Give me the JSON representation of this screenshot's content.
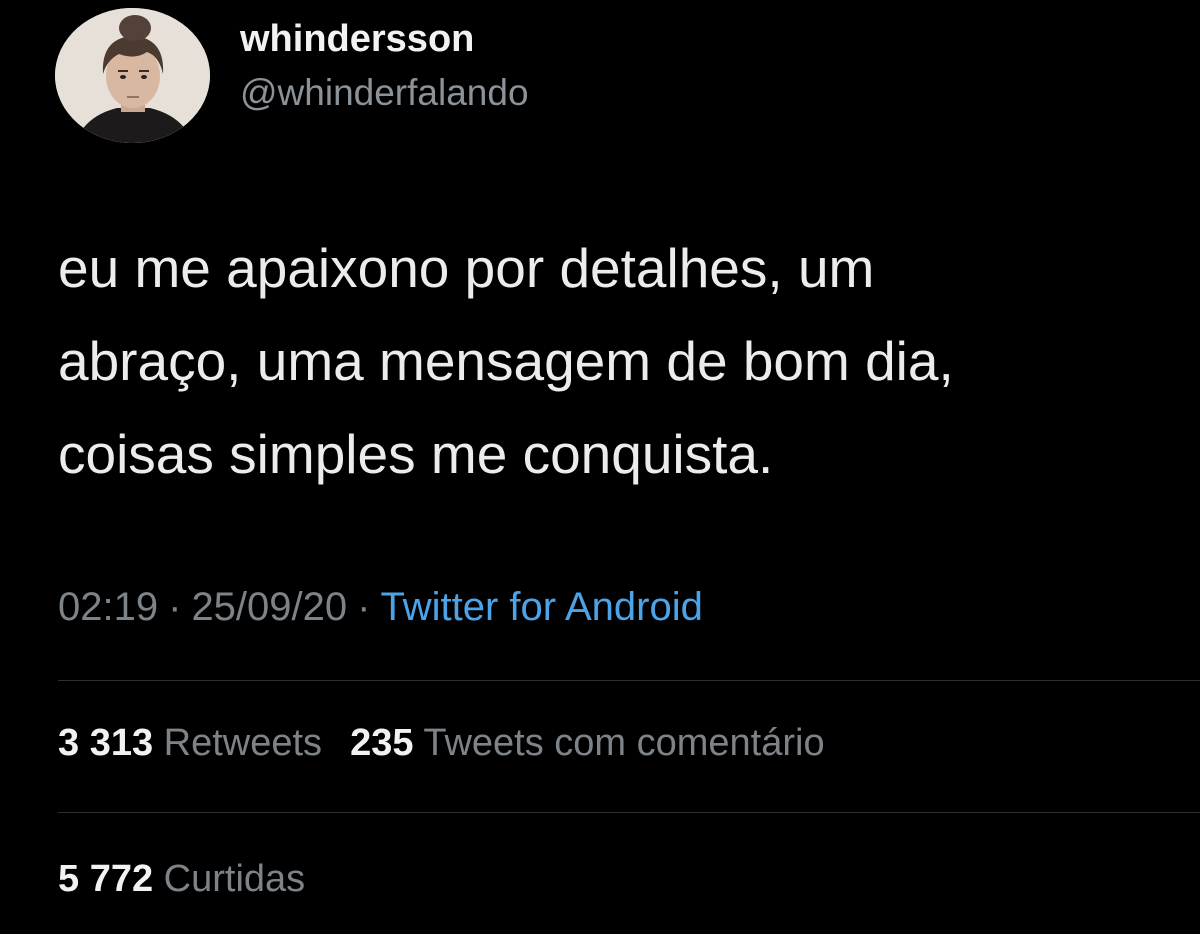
{
  "author": {
    "display_name": "whindersson",
    "handle": "@whinderfalando"
  },
  "tweet": {
    "lines": [
      "eu me apaixono por detalhes, um",
      "abraço, uma mensagem de bom dia,",
      "coisas simples me conquista."
    ]
  },
  "meta": {
    "time": "02:19",
    "separator": "·",
    "date": "25/09/20",
    "source": "Twitter for Android"
  },
  "stats": {
    "retweets_count": "3 313",
    "retweets_label": "Retweets",
    "quotes_count": "235",
    "quotes_label": "Tweets com comentário",
    "likes_count": "5 772",
    "likes_label": "Curtidas"
  },
  "colors": {
    "background": "#000000",
    "text": "#ececec",
    "secondary_text": "#7c8389",
    "link": "#4da3e8",
    "divider": "#2b3035"
  }
}
